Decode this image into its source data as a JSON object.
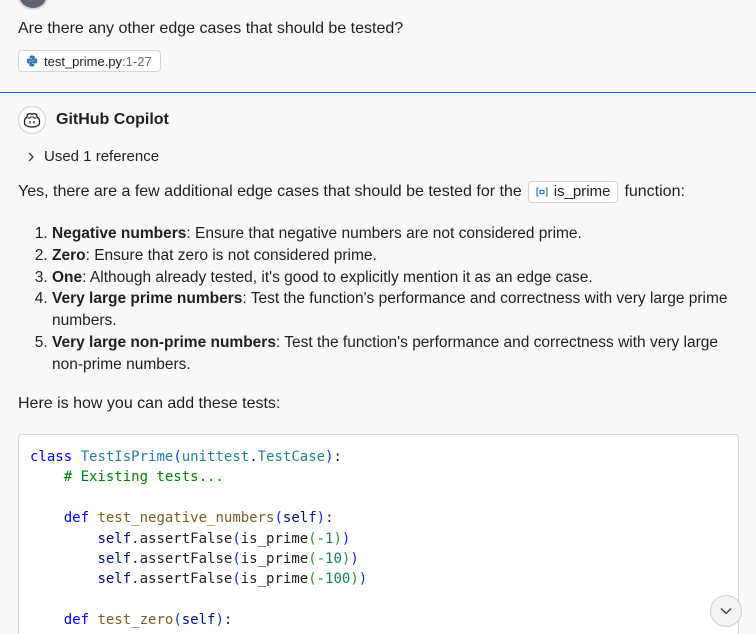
{
  "user_message": {
    "question": "Are there any other edge cases that should be tested?",
    "reference": {
      "file": "test_prime.py",
      "range": ":1-27",
      "icon": "python-icon"
    }
  },
  "response": {
    "author": "GitHub Copilot",
    "used_references_label": "Used 1 reference",
    "intro_before": "Yes, there are a few additional edge cases that should be tested for the",
    "symbol": "is_prime",
    "intro_after": "function:",
    "edge_cases": [
      {
        "term": "Negative numbers",
        "text": ": Ensure that negative numbers are not considered prime."
      },
      {
        "term": "Zero",
        "text": ": Ensure that zero is not considered prime."
      },
      {
        "term": "One",
        "text": ": Although already tested, it's good to explicitly mention it as an edge case."
      },
      {
        "term": "Very large prime numbers",
        "text": ": Test the function's performance and correctness with very large prime numbers."
      },
      {
        "term": "Very large non-prime numbers",
        "text": ": Test the function's performance and correctness with very large non-prime numbers."
      }
    ],
    "code_intro": "Here is how you can add these tests:",
    "code": {
      "class_kw": "class",
      "class_name": "TestIsPrime",
      "base_module": "unittest",
      "base_class": "TestCase",
      "comment": "# Existing tests...",
      "def_kw": "def",
      "method_negative": "test_negative_numbers",
      "method_zero": "test_zero",
      "self": "self",
      "assert_call": "assertFalse",
      "func": "is_prime",
      "negative_values": [
        "-1",
        "-10",
        "-100"
      ]
    }
  },
  "scroll_button": {
    "icon": "chevron-down-icon"
  }
}
